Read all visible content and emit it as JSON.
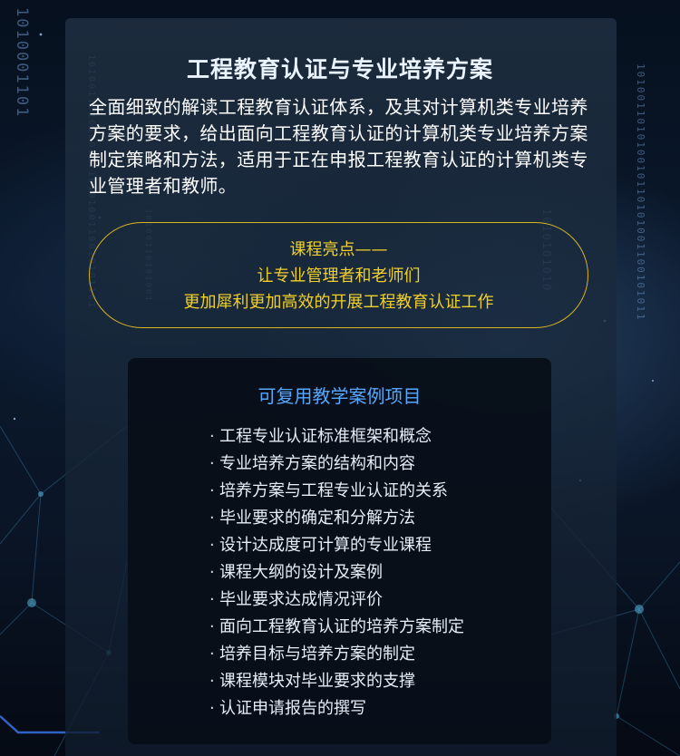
{
  "header": {
    "title": "工程教育认证与专业培养方案"
  },
  "intro": {
    "text": "全面细致的解读工程教育认证体系，及其对计算机类专业培养方案的要求，给出面向工程教育认证的计算机类专业培养方案制定策略和方法，适用于正在申报工程教育认证的计算机类专业管理者和教师。"
  },
  "highlight": {
    "line1": "课程亮点——",
    "line2": "让专业管理者和老师们",
    "line3": "更加犀利更加高效的开展工程教育认证工作"
  },
  "cases": {
    "title": "可复用教学案例项目",
    "bullet": "·",
    "items": [
      "工程专业认证标准框架和概念",
      "专业培养方案的结构和内容",
      "培养方案与工程专业认证的关系",
      "毕业要求的确定和分解方法",
      "设计达成度可计算的专业课程",
      "课程大纲的设计及案例",
      "毕业要求达成情况评价",
      "面向工程教育认证的培养方案制定",
      "培养目标与培养方案的制定",
      "课程模块对毕业要求的支撑",
      "认证申请报告的撰写"
    ]
  },
  "colors": {
    "title": "#e9f4ff",
    "highlight": "#f2d028",
    "cases_title": "#56a8ff",
    "panel": "#1c2c40"
  }
}
